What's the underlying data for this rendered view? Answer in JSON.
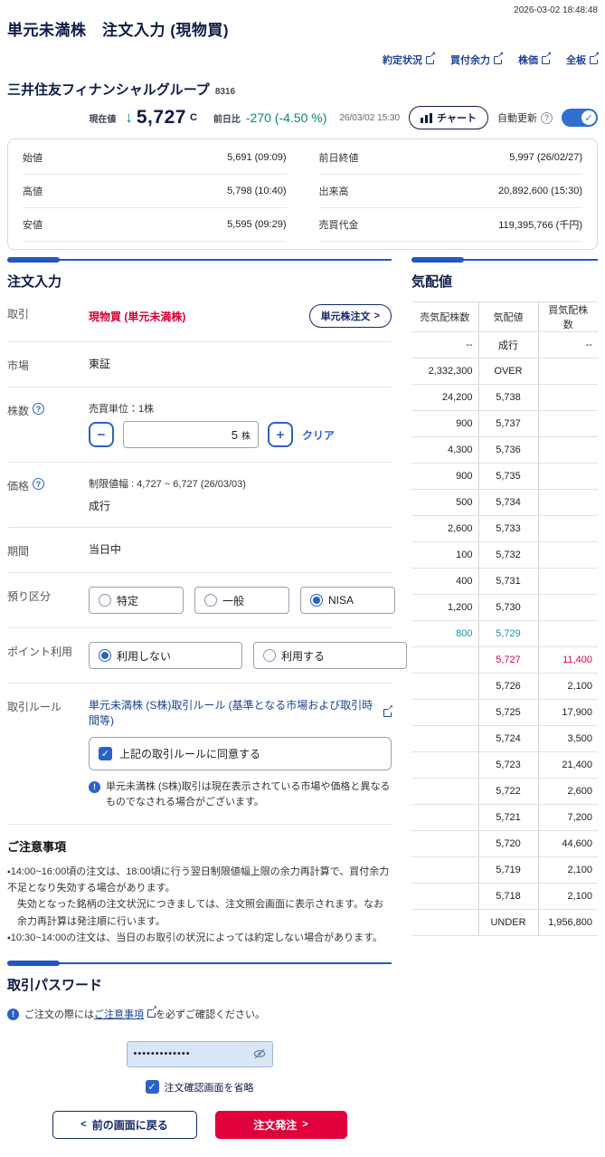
{
  "meta": {
    "timestamp": "2026-03-02 18:48:48"
  },
  "header": {
    "title": "単元未満株　注文入力 (現物買)",
    "links": {
      "0": "約定状況",
      "1": "買付余力",
      "2": "株価",
      "3": "全板"
    }
  },
  "stock": {
    "name": "三井住友フィナンシャルグループ",
    "code": "8316",
    "price_label": "現在値",
    "down_arrow": "↓",
    "price": "5,727",
    "price_suffix": "C",
    "change_label": "前日比",
    "change": "-270 (-4.50 %)",
    "time": "26/03/02 15:30",
    "chart_button": "チャート",
    "auto_update_label": "自動更新",
    "help_glyph": "?",
    "check_glyph": "✓",
    "colors": {
      "down": "#0c8577",
      "accent": "#2356c5",
      "buy_red": "#d70032"
    }
  },
  "summary": {
    "rows": {
      "0": {
        "l_label": "始値",
        "l_value": "5,691 (09:09)",
        "r_label": "前日終値",
        "r_value": "5,997 (26/02/27)"
      },
      "1": {
        "l_label": "高値",
        "l_value": "5,798 (10:40)",
        "r_label": "出来高",
        "r_value": "20,892,600 (15:30)"
      },
      "2": {
        "l_label": "安値",
        "l_value": "5,595 (09:29)",
        "r_label": "売買代金",
        "r_value": "119,395,766 (千円)"
      }
    }
  },
  "order": {
    "section_title": "注文入力",
    "trade_label": "取引",
    "trade_value": "現物買 (単元未満株)",
    "unit_order_button": "単元株注文",
    "market_label": "市場",
    "market_value": "東証",
    "qty_label": "株数",
    "qty_unit_note": "売買単位：1株",
    "qty_minus": "−",
    "qty_value": "5",
    "qty_suffix": "株",
    "qty_plus": "+",
    "clear_label": "クリア",
    "price_label": "価格",
    "price_limit_note": "制限値幅 :  4,727 ~ 6,727 (26/03/03)",
    "price_value": "成行",
    "period_label": "期間",
    "period_value": "当日中",
    "account_label": "預り区分",
    "account_options": {
      "0": "特定",
      "1": "一般",
      "2": "NISA"
    },
    "point_label": "ポイント利用",
    "point_options": {
      "0": "利用しない",
      "1": "利用する"
    },
    "rule_label": "取引ルール",
    "rule_link": "単元未満株 (S株)取引ルール (基準となる市場および取引時間等)",
    "rule_agree": "上記の取引ルールに同意する",
    "rule_note": "単元未満株 (S株)取引は現在表示されている市場や価格と異なるものでなされる場合がございます。"
  },
  "notices": {
    "title": "ご注意事項",
    "lines": {
      "0": "・14:00~16:00頃の注文は、18:00頃に行う翌日制限値幅上限の余力再計算で、買付余力不足となり失効する場合があります。",
      "1": "失効となった銘柄の注文状況につきましては、注文照会画面に表示されます。なお余力再計算は発注順に行います。",
      "2": "・10:30~14:00の注文は、当日のお取引の状況によっては約定しない場合があります。"
    }
  },
  "password": {
    "section_title": "取引パスワード",
    "note_pre": "ご注文の際には",
    "note_link": "ご注意事項",
    "note_post": "を必ずご確認ください。",
    "masked_value": "•••••••••••••",
    "skip_confirm_label": "注文確認画面を省略",
    "back_button": "前の画面に戻る",
    "submit_button": "注文発注"
  },
  "board": {
    "section_title": "気配値",
    "headers": {
      "sell": "売気配株数",
      "price": "気配値",
      "buy": "買気配株数"
    },
    "rows": [
      {
        "sell": "--",
        "price": "成行",
        "buy": "--",
        "tone": ""
      },
      {
        "sell": "2,332,300",
        "price": "OVER",
        "buy": "",
        "tone": ""
      },
      {
        "sell": "24,200",
        "price": "5,738",
        "buy": "",
        "tone": ""
      },
      {
        "sell": "900",
        "price": "5,737",
        "buy": "",
        "tone": ""
      },
      {
        "sell": "4,300",
        "price": "5,736",
        "buy": "",
        "tone": ""
      },
      {
        "sell": "900",
        "price": "5,735",
        "buy": "",
        "tone": ""
      },
      {
        "sell": "500",
        "price": "5,734",
        "buy": "",
        "tone": ""
      },
      {
        "sell": "2,600",
        "price": "5,733",
        "buy": "",
        "tone": ""
      },
      {
        "sell": "100",
        "price": "5,732",
        "buy": "",
        "tone": ""
      },
      {
        "sell": "400",
        "price": "5,731",
        "buy": "",
        "tone": ""
      },
      {
        "sell": "1,200",
        "price": "5,730",
        "buy": "",
        "tone": ""
      },
      {
        "sell": "800",
        "price": "5,729",
        "buy": "",
        "tone": "sell-best"
      },
      {
        "sell": "",
        "price": "5,727",
        "buy": "11,400",
        "tone": "last"
      },
      {
        "sell": "",
        "price": "5,726",
        "buy": "2,100",
        "tone": ""
      },
      {
        "sell": "",
        "price": "5,725",
        "buy": "17,900",
        "tone": ""
      },
      {
        "sell": "",
        "price": "5,724",
        "buy": "3,500",
        "tone": ""
      },
      {
        "sell": "",
        "price": "5,723",
        "buy": "21,400",
        "tone": ""
      },
      {
        "sell": "",
        "price": "5,722",
        "buy": "2,600",
        "tone": ""
      },
      {
        "sell": "",
        "price": "5,721",
        "buy": "7,200",
        "tone": ""
      },
      {
        "sell": "",
        "price": "5,720",
        "buy": "44,600",
        "tone": ""
      },
      {
        "sell": "",
        "price": "5,719",
        "buy": "2,100",
        "tone": ""
      },
      {
        "sell": "",
        "price": "5,718",
        "buy": "2,100",
        "tone": ""
      },
      {
        "sell": "",
        "price": "UNDER",
        "buy": "1,956,800",
        "tone": ""
      }
    ]
  }
}
